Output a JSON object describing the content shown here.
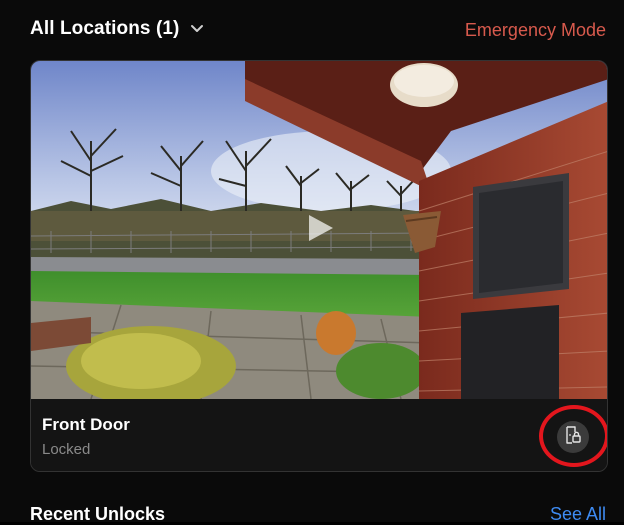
{
  "header": {
    "location_title": "All Locations (1)",
    "emergency_label": "Emergency Mode"
  },
  "device": {
    "name": "Front Door",
    "status": "Locked"
  },
  "recent": {
    "title": "Recent Unlocks",
    "see_all_label": "See All"
  },
  "icons": {
    "dropdown": "chevron-down-icon",
    "play": "play-icon",
    "lock": "door-lock-icon"
  },
  "colors": {
    "emergency": "#d85a4d",
    "link": "#3e8bf2",
    "highlight": "#e3161d"
  }
}
